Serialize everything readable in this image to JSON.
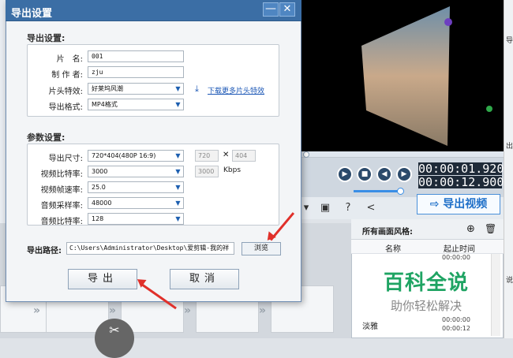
{
  "dialog": {
    "title": "导出设置",
    "min_glyph": "—",
    "close_glyph": "✕",
    "export_section": "导出设置:",
    "name_label": "片　名:",
    "name_value": "001",
    "author_label": "制 作 者:",
    "author_value": "zju",
    "intro_label": "片头特效:",
    "intro_value": "好莱坞风潮",
    "download_link": "下载更多片头特效",
    "format_label": "导出格式:",
    "format_value": "MP4格式",
    "param_section": "参数设置:",
    "size_label": "导出尺寸:",
    "size_value": "720*404(480P 16:9)",
    "size_w": "720",
    "size_x": "✕",
    "size_h": "404",
    "vbitrate_label": "视频比特率:",
    "vbitrate_value": "3000",
    "vbitrate_custom": "3000",
    "vbitrate_unit": "Kbps",
    "fps_label": "视频帧速率:",
    "fps_value": "25.0",
    "asample_label": "音频采样率:",
    "asample_value": "48000",
    "abitrate_label": "音频比特率:",
    "abitrate_value": "128",
    "path_label": "导出路径:",
    "path_value": "C:\\Users\\Administrator\\Desktop\\爱剪辑-我的祥",
    "browse": "浏览",
    "export_btn": "导出",
    "cancel_btn": "取消"
  },
  "player": {
    "time_current": "00:00:01.920",
    "time_total": "00:00:12.900",
    "export_video": "导出视频"
  },
  "style_panel": {
    "title": "所有画面风格:",
    "col_name": "名称",
    "col_time": "起止时间",
    "rows": [
      {
        "name": "",
        "t1": "00:00:00",
        "t2": ""
      },
      {
        "name": "淡雅",
        "t1": "00:00:00",
        "t2": "00:00:12"
      }
    ]
  },
  "watermark": {
    "line1": "百科全说",
    "line2": "助你轻松解决"
  },
  "edge_texts": [
    "导",
    "出",
    "说"
  ],
  "colors": {
    "title_bar": "#3b6ea5",
    "accent": "#1e6fc8",
    "arrow": "#e0302a",
    "watermark": "#1fa463"
  }
}
